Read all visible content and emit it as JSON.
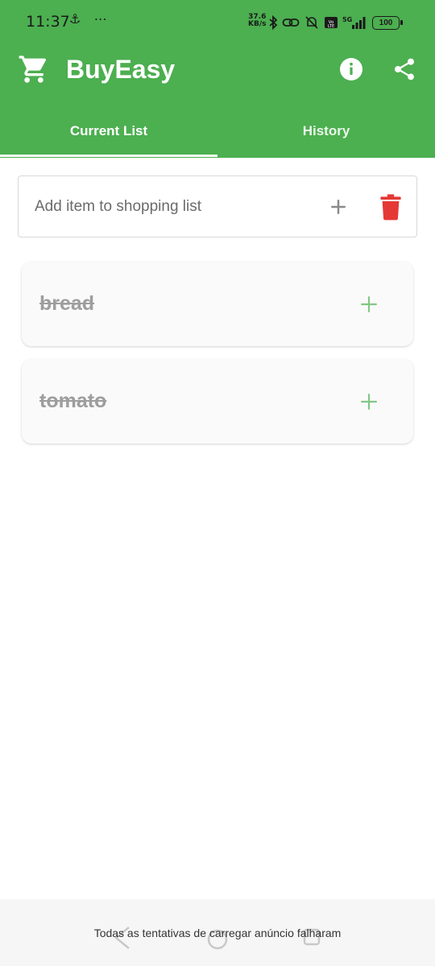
{
  "status_bar": {
    "time": "11:37",
    "left_icons": "⚓ ⋯",
    "net_speed_value": "37.6",
    "net_speed_unit": "KB/s",
    "network": "5G",
    "battery": "100"
  },
  "app": {
    "title": "BuyEasy",
    "brand_color": "#4caf50"
  },
  "tabs": [
    {
      "label": "Current List",
      "selected": true
    },
    {
      "label": "History",
      "selected": false
    }
  ],
  "add_item": {
    "placeholder": "Add item to shopping list",
    "value": ""
  },
  "items": [
    {
      "name": "bread",
      "checked": true
    },
    {
      "name": "tomato",
      "checked": true
    }
  ],
  "ad_banner": {
    "text": "Todas as tentativas de carregar anúncio falharam"
  },
  "icons": {
    "cart": "cart-icon",
    "info": "info-icon",
    "share": "share-icon",
    "add": "plus-icon",
    "delete": "trash-icon"
  }
}
